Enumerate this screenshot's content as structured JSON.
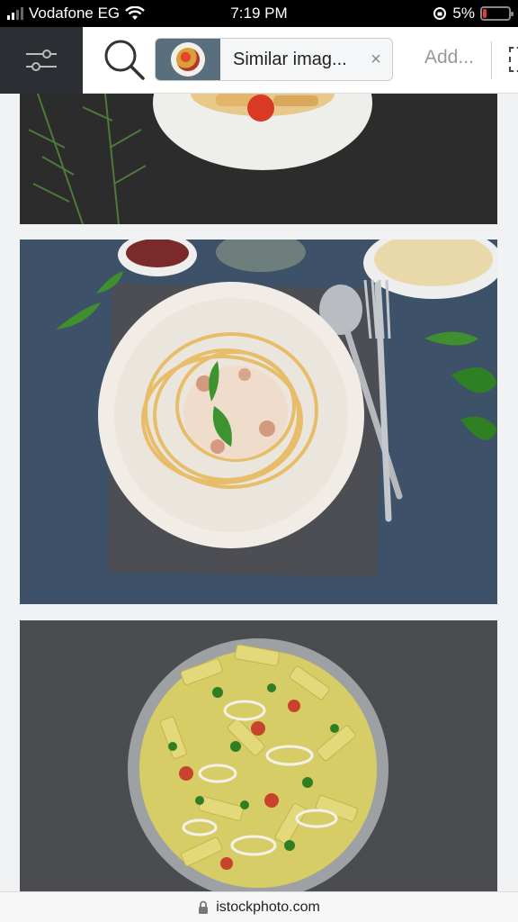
{
  "status_bar": {
    "carrier": "Vodafone EG",
    "time": "7:19 PM",
    "battery": "5%",
    "battery_level": 0.05
  },
  "toolbar": {
    "filter_icon": "sliders-icon",
    "search_icon": "search-icon",
    "chip_label": "Similar imag...",
    "chip_close": "×",
    "add_label": "Add..."
  },
  "feed": {
    "images": [
      {
        "name": "pasta-plate-rosemary"
      },
      {
        "name": "spaghetti-carbonara-basil"
      },
      {
        "name": "penne-squid-pot"
      }
    ]
  },
  "bottom_bar": {
    "lock_icon": "lock-icon",
    "domain": "istockphoto.com"
  },
  "colors": {
    "status_bg": "#000000",
    "filter_bg": "#2b2f33",
    "battery_low": "#e53935"
  }
}
